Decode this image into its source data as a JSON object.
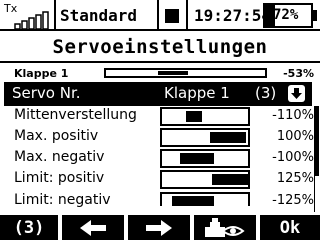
{
  "status": {
    "tx_label": "Tx",
    "model_name": "Standard",
    "time": "19:27:54",
    "battery": "72%"
  },
  "screen": {
    "title": "Servoeinstellungen"
  },
  "summary": {
    "label": "Klappe 1",
    "value": "-53%",
    "level_percent": -53
  },
  "selected_row": {
    "label": "Servo Nr.",
    "value": "Klappe 1",
    "number": "(3)",
    "icon": "dropdown-arrow-icon"
  },
  "rows": [
    {
      "label": "Mittenverstellung",
      "value": "-110%"
    },
    {
      "label": "Max. positiv",
      "value": "100%"
    },
    {
      "label": "Max. negativ",
      "value": "-100%"
    },
    {
      "label": "Limit: positiv",
      "value": "125%"
    },
    {
      "label": "Limit: negativ",
      "value": "-125%"
    }
  ],
  "softkeys": {
    "k1": "(3)",
    "k2_icon": "arrow-left-icon",
    "k3_icon": "arrow-right-icon",
    "k4_icon": "servo-view-icon",
    "k5": "Ok"
  }
}
